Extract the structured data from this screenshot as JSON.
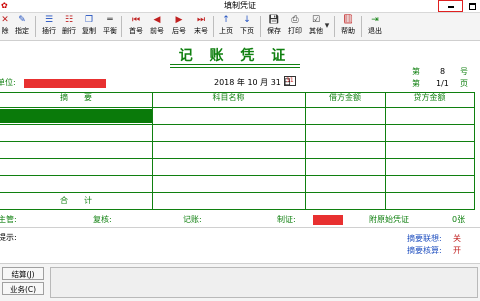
{
  "window": {
    "title": "填制凭证"
  },
  "toolbar": {
    "buttons": [
      {
        "label": "除",
        "icon": "delete-icon"
      },
      {
        "label": "指定",
        "icon": "assign-icon"
      },
      {
        "label": "插行",
        "icon": "insert-row-icon"
      },
      {
        "label": "删行",
        "icon": "delete-row-icon"
      },
      {
        "label": "复制",
        "icon": "copy-icon"
      },
      {
        "label": "平衡",
        "icon": "balance-icon"
      },
      {
        "label": "首号",
        "icon": "first-icon"
      },
      {
        "label": "前号",
        "icon": "previous-icon"
      },
      {
        "label": "后号",
        "icon": "next-icon"
      },
      {
        "label": "末号",
        "icon": "last-icon"
      },
      {
        "label": "上页",
        "icon": "page-up-icon"
      },
      {
        "label": "下页",
        "icon": "page-down-icon"
      },
      {
        "label": "保存",
        "icon": "save-icon"
      },
      {
        "label": "打印",
        "icon": "print-icon"
      },
      {
        "label": "其他",
        "icon": "other-icon"
      },
      {
        "label": "帮助",
        "icon": "help-icon"
      },
      {
        "label": "退出",
        "icon": "exit-icon"
      }
    ]
  },
  "voucher": {
    "title": "记 账 凭 证",
    "unit_label": "单位:",
    "date": "2018 年 10 月 31 日",
    "calendar_glyph": "31",
    "number_label": "第",
    "number_value": "8",
    "number_suffix": "号",
    "page_label": "第",
    "page_value": "1/1",
    "page_suffix": "页",
    "columns": [
      "摘　　要",
      "科目名称",
      "借方金额",
      "贷方金额"
    ],
    "total_label": "合　　计",
    "footer": {
      "supervisor": "主管:",
      "reviewer": "复核:",
      "bookkeeper": "记账:",
      "maker": "制证:",
      "attachments_label": "附原始凭证",
      "attachments_count": "0张"
    }
  },
  "status": {
    "prompt_label": "提示:",
    "summary_link_label": "摘要联想:",
    "summary_link_value": "关",
    "summary_check_label": "摘要核算:",
    "summary_check_value": "开"
  },
  "side_buttons": [
    "结算(J)",
    "业务(C)"
  ],
  "colors": {
    "voucher_green": "#108010",
    "selected_row": "#0a7a0a",
    "redacted": "#e83030"
  }
}
